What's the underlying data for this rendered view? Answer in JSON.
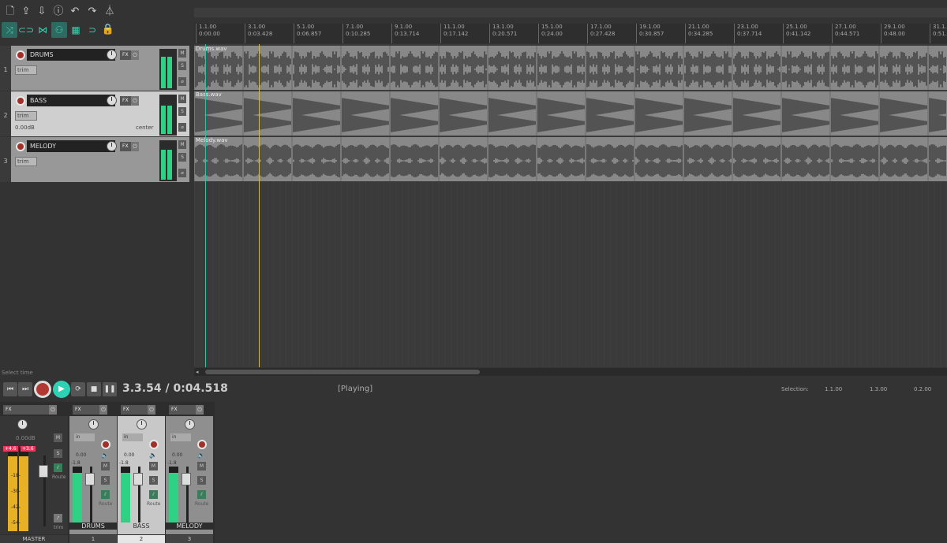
{
  "tracks": [
    {
      "num": "1",
      "name": "DRUMS",
      "trim": "trim",
      "state": "normal",
      "vol": "",
      "pan": "",
      "fx": "FX",
      "mute": "M",
      "solo": "S",
      "phase": "⌀"
    },
    {
      "num": "2",
      "name": "BASS",
      "trim": "trim",
      "state": "selected",
      "vol": "0.00dB",
      "pan": "center",
      "fx": "FX",
      "mute": "M",
      "solo": "S",
      "phase": "⌀"
    },
    {
      "num": "3",
      "name": "MELODY",
      "trim": "trim",
      "state": "normal",
      "vol": "",
      "pan": "",
      "fx": "FX",
      "mute": "M",
      "solo": "S",
      "phase": "⌀"
    }
  ],
  "ruler": [
    {
      "bar": "1.1.00",
      "time": "0:00.00"
    },
    {
      "bar": "3.1.00",
      "time": "0:03.428"
    },
    {
      "bar": "5.1.00",
      "time": "0:06.857"
    },
    {
      "bar": "7.1.00",
      "time": "0:10.285"
    },
    {
      "bar": "9.1.00",
      "time": "0:13.714"
    },
    {
      "bar": "11.1.00",
      "time": "0:17.142"
    },
    {
      "bar": "13.1.00",
      "time": "0:20.571"
    },
    {
      "bar": "15.1.00",
      "time": "0:24.00"
    },
    {
      "bar": "17.1.00",
      "time": "0:27.428"
    },
    {
      "bar": "19.1.00",
      "time": "0:30.857"
    },
    {
      "bar": "21.1.00",
      "time": "0:34.285"
    },
    {
      "bar": "23.1.00",
      "time": "0:37.714"
    },
    {
      "bar": "25.1.00",
      "time": "0:41.142"
    },
    {
      "bar": "27.1.00",
      "time": "0:44.571"
    },
    {
      "bar": "29.1.00",
      "time": "0:48.00"
    },
    {
      "bar": "31.1.00",
      "time": "0:51.428"
    }
  ],
  "items": [
    {
      "file": "Drums.wav"
    },
    {
      "file": "Bass.wav"
    },
    {
      "file": "Melody.wav"
    }
  ],
  "hint": "Select time",
  "transport": {
    "position": "3.3.54 / 0:04.518",
    "state": "[Playing]"
  },
  "selection": {
    "label": "Selection:",
    "start": "1.1.00",
    "end": "1.3.00",
    "length": "0.2.00"
  },
  "mixer": {
    "master": {
      "name": "MASTER",
      "vol": "0.00dB",
      "peak_l": "+4.6",
      "peak_r": "+3.6",
      "scale": [
        "-18-",
        "-30-",
        "-42-",
        "-54-"
      ],
      "route": "Route",
      "trim": "trim",
      "mute": "M",
      "solo": "S",
      "fx": "FX"
    },
    "strips": [
      {
        "num": "1",
        "name": "DRUMS",
        "vol": "0.00",
        "peak": "-1.8",
        "in": "in",
        "route": "Route",
        "mute": "M",
        "solo": "S",
        "fx": "FX"
      },
      {
        "num": "2",
        "name": "BASS",
        "vol": "0.00",
        "peak": "-1.8",
        "in": "in",
        "route": "Route",
        "mute": "M",
        "solo": "S",
        "fx": "FX"
      },
      {
        "num": "3",
        "name": "MELODY",
        "vol": "0.00",
        "peak": "-1.8",
        "in": "in",
        "route": "Route",
        "mute": "M",
        "solo": "S",
        "fx": "FX"
      }
    ]
  },
  "colors": {
    "accent": "#2fd1b4",
    "meter": "#2fd184",
    "record": "#b03a33",
    "edit_cursor": "#d8b84a",
    "play_cursor": "#33c0a6",
    "master_meter": "#e8b024",
    "clip_peak": "#e83a5c"
  }
}
